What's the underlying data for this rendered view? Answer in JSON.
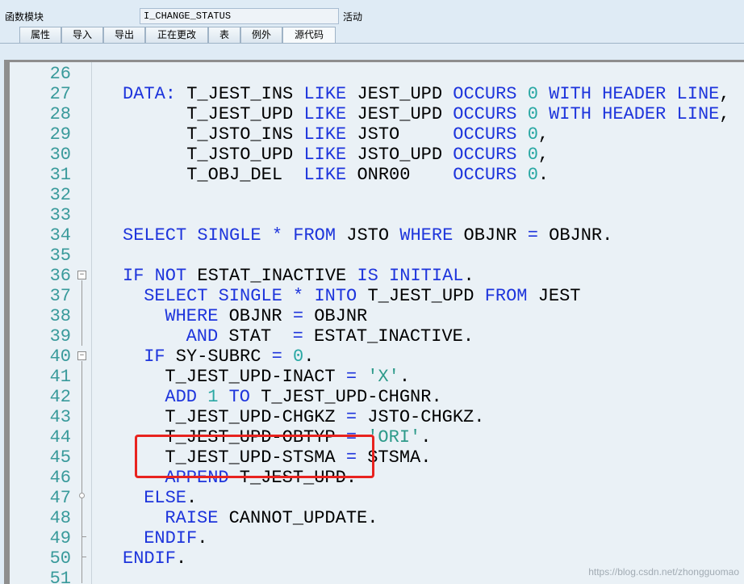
{
  "header": {
    "label": "函数模块",
    "function_name": "I_CHANGE_STATUS",
    "status": "活动"
  },
  "tabs": [
    {
      "label": "属性",
      "active": false
    },
    {
      "label": "导入",
      "active": false
    },
    {
      "label": "导出",
      "active": false
    },
    {
      "label": "正在更改",
      "active": false
    },
    {
      "label": "表",
      "active": false
    },
    {
      "label": "例外",
      "active": false
    },
    {
      "label": "源代码",
      "active": true
    }
  ],
  "colors": {
    "keyword": "#1e35dc",
    "number": "#2aa8a4",
    "string": "#2d9a8a",
    "line_number": "#399a9b",
    "highlight_box": "#e8231f"
  },
  "code_lines": [
    {
      "n": "26",
      "indent": 0,
      "tokens": []
    },
    {
      "n": "27",
      "indent": 0,
      "tokens": [
        {
          "t": "kw",
          "v": "DATA:"
        },
        {
          "t": "plain",
          "v": " T_JEST_INS "
        },
        {
          "t": "kw",
          "v": "LIKE"
        },
        {
          "t": "plain",
          "v": " JEST_UPD "
        },
        {
          "t": "kw",
          "v": "OCCURS"
        },
        {
          "t": "num",
          "v": " 0 "
        },
        {
          "t": "kw",
          "v": "WITH HEADER LINE"
        },
        {
          "t": "plain",
          "v": ","
        }
      ]
    },
    {
      "n": "28",
      "indent": 0,
      "tokens": [
        {
          "t": "plain",
          "v": "      T_JEST_UPD "
        },
        {
          "t": "kw",
          "v": "LIKE"
        },
        {
          "t": "plain",
          "v": " JEST_UPD "
        },
        {
          "t": "kw",
          "v": "OCCURS"
        },
        {
          "t": "num",
          "v": " 0 "
        },
        {
          "t": "kw",
          "v": "WITH HEADER LINE"
        },
        {
          "t": "plain",
          "v": ","
        }
      ]
    },
    {
      "n": "29",
      "indent": 0,
      "tokens": [
        {
          "t": "plain",
          "v": "      T_JSTO_INS "
        },
        {
          "t": "kw",
          "v": "LIKE"
        },
        {
          "t": "plain",
          "v": " JSTO     "
        },
        {
          "t": "kw",
          "v": "OCCURS"
        },
        {
          "t": "num",
          "v": " 0"
        },
        {
          "t": "plain",
          "v": ","
        }
      ]
    },
    {
      "n": "30",
      "indent": 0,
      "tokens": [
        {
          "t": "plain",
          "v": "      T_JSTO_UPD "
        },
        {
          "t": "kw",
          "v": "LIKE"
        },
        {
          "t": "plain",
          "v": " JSTO_UPD "
        },
        {
          "t": "kw",
          "v": "OCCURS"
        },
        {
          "t": "num",
          "v": " 0"
        },
        {
          "t": "plain",
          "v": ","
        }
      ]
    },
    {
      "n": "31",
      "indent": 0,
      "tokens": [
        {
          "t": "plain",
          "v": "      T_OBJ_DEL  "
        },
        {
          "t": "kw",
          "v": "LIKE"
        },
        {
          "t": "plain",
          "v": " ONR00    "
        },
        {
          "t": "kw",
          "v": "OCCURS"
        },
        {
          "t": "num",
          "v": " 0"
        },
        {
          "t": "plain",
          "v": "."
        }
      ]
    },
    {
      "n": "32",
      "indent": 0,
      "tokens": []
    },
    {
      "n": "33",
      "indent": 0,
      "tokens": []
    },
    {
      "n": "34",
      "indent": 0,
      "tokens": [
        {
          "t": "kw",
          "v": "SELECT SINGLE"
        },
        {
          "t": "plain",
          "v": " "
        },
        {
          "t": "kw",
          "v": "*"
        },
        {
          "t": "plain",
          "v": " "
        },
        {
          "t": "kw",
          "v": "FROM"
        },
        {
          "t": "plain",
          "v": " JSTO "
        },
        {
          "t": "kw",
          "v": "WHERE"
        },
        {
          "t": "plain",
          "v": " OBJNR "
        },
        {
          "t": "kw",
          "v": "="
        },
        {
          "t": "plain",
          "v": " OBJNR."
        }
      ]
    },
    {
      "n": "35",
      "indent": 0,
      "tokens": []
    },
    {
      "n": "36",
      "indent": 0,
      "tokens": [
        {
          "t": "kw",
          "v": "IF NOT"
        },
        {
          "t": "plain",
          "v": " ESTAT_INACTIVE "
        },
        {
          "t": "kw",
          "v": "IS INITIAL"
        },
        {
          "t": "plain",
          "v": "."
        }
      ]
    },
    {
      "n": "37",
      "indent": 2,
      "tokens": [
        {
          "t": "kw",
          "v": "SELECT SINGLE"
        },
        {
          "t": "plain",
          "v": " "
        },
        {
          "t": "kw",
          "v": "*"
        },
        {
          "t": "plain",
          "v": " "
        },
        {
          "t": "kw",
          "v": "INTO"
        },
        {
          "t": "plain",
          "v": " T_JEST_UPD "
        },
        {
          "t": "kw",
          "v": "FROM"
        },
        {
          "t": "plain",
          "v": " JEST"
        }
      ]
    },
    {
      "n": "38",
      "indent": 4,
      "tokens": [
        {
          "t": "kw",
          "v": "WHERE"
        },
        {
          "t": "plain",
          "v": " OBJNR "
        },
        {
          "t": "kw",
          "v": "="
        },
        {
          "t": "plain",
          "v": " OBJNR"
        }
      ]
    },
    {
      "n": "39",
      "indent": 6,
      "tokens": [
        {
          "t": "kw",
          "v": "AND"
        },
        {
          "t": "plain",
          "v": " STAT  "
        },
        {
          "t": "kw",
          "v": "="
        },
        {
          "t": "plain",
          "v": " ESTAT_INACTIVE."
        }
      ]
    },
    {
      "n": "40",
      "indent": 2,
      "tokens": [
        {
          "t": "kw",
          "v": "IF"
        },
        {
          "t": "plain",
          "v": " SY-SUBRC "
        },
        {
          "t": "kw",
          "v": "="
        },
        {
          "t": "num",
          "v": " 0"
        },
        {
          "t": "plain",
          "v": "."
        }
      ]
    },
    {
      "n": "41",
      "indent": 4,
      "tokens": [
        {
          "t": "plain",
          "v": "T_JEST_UPD-INACT "
        },
        {
          "t": "kw",
          "v": "="
        },
        {
          "t": "plain",
          "v": " "
        },
        {
          "t": "str",
          "v": "'X'"
        },
        {
          "t": "plain",
          "v": "."
        }
      ]
    },
    {
      "n": "42",
      "indent": 4,
      "tokens": [
        {
          "t": "kw",
          "v": "ADD"
        },
        {
          "t": "num",
          "v": " 1 "
        },
        {
          "t": "kw",
          "v": "TO"
        },
        {
          "t": "plain",
          "v": " T_JEST_UPD-CHGNR."
        }
      ]
    },
    {
      "n": "43",
      "indent": 4,
      "tokens": [
        {
          "t": "plain",
          "v": "T_JEST_UPD-CHGKZ "
        },
        {
          "t": "kw",
          "v": "="
        },
        {
          "t": "plain",
          "v": " JSTO-CHGKZ."
        }
      ]
    },
    {
      "n": "44",
      "indent": 4,
      "tokens": [
        {
          "t": "plain",
          "v": "T_JEST_UPD-OBTYP "
        },
        {
          "t": "kw",
          "v": "="
        },
        {
          "t": "plain",
          "v": " "
        },
        {
          "t": "str",
          "v": "'ORI'"
        },
        {
          "t": "plain",
          "v": "."
        }
      ]
    },
    {
      "n": "45",
      "indent": 4,
      "tokens": [
        {
          "t": "plain",
          "v": "T_JEST_UPD-STSMA "
        },
        {
          "t": "kw",
          "v": "="
        },
        {
          "t": "plain",
          "v": " STSMA."
        }
      ]
    },
    {
      "n": "46",
      "indent": 4,
      "tokens": [
        {
          "t": "kw",
          "v": "APPEND"
        },
        {
          "t": "plain",
          "v": " T_JEST_UPD."
        }
      ]
    },
    {
      "n": "47",
      "indent": 2,
      "tokens": [
        {
          "t": "kw",
          "v": "ELSE"
        },
        {
          "t": "plain",
          "v": "."
        }
      ]
    },
    {
      "n": "48",
      "indent": 4,
      "tokens": [
        {
          "t": "kw",
          "v": "RAISE"
        },
        {
          "t": "plain",
          "v": " CANNOT_UPDATE."
        }
      ]
    },
    {
      "n": "49",
      "indent": 2,
      "tokens": [
        {
          "t": "kw",
          "v": "ENDIF"
        },
        {
          "t": "plain",
          "v": "."
        }
      ]
    },
    {
      "n": "50",
      "indent": 0,
      "tokens": [
        {
          "t": "kw",
          "v": "ENDIF"
        },
        {
          "t": "plain",
          "v": "."
        }
      ]
    },
    {
      "n": "51",
      "indent": 0,
      "tokens": []
    }
  ],
  "watermark": "https://blog.csdn.net/zhongguomao"
}
